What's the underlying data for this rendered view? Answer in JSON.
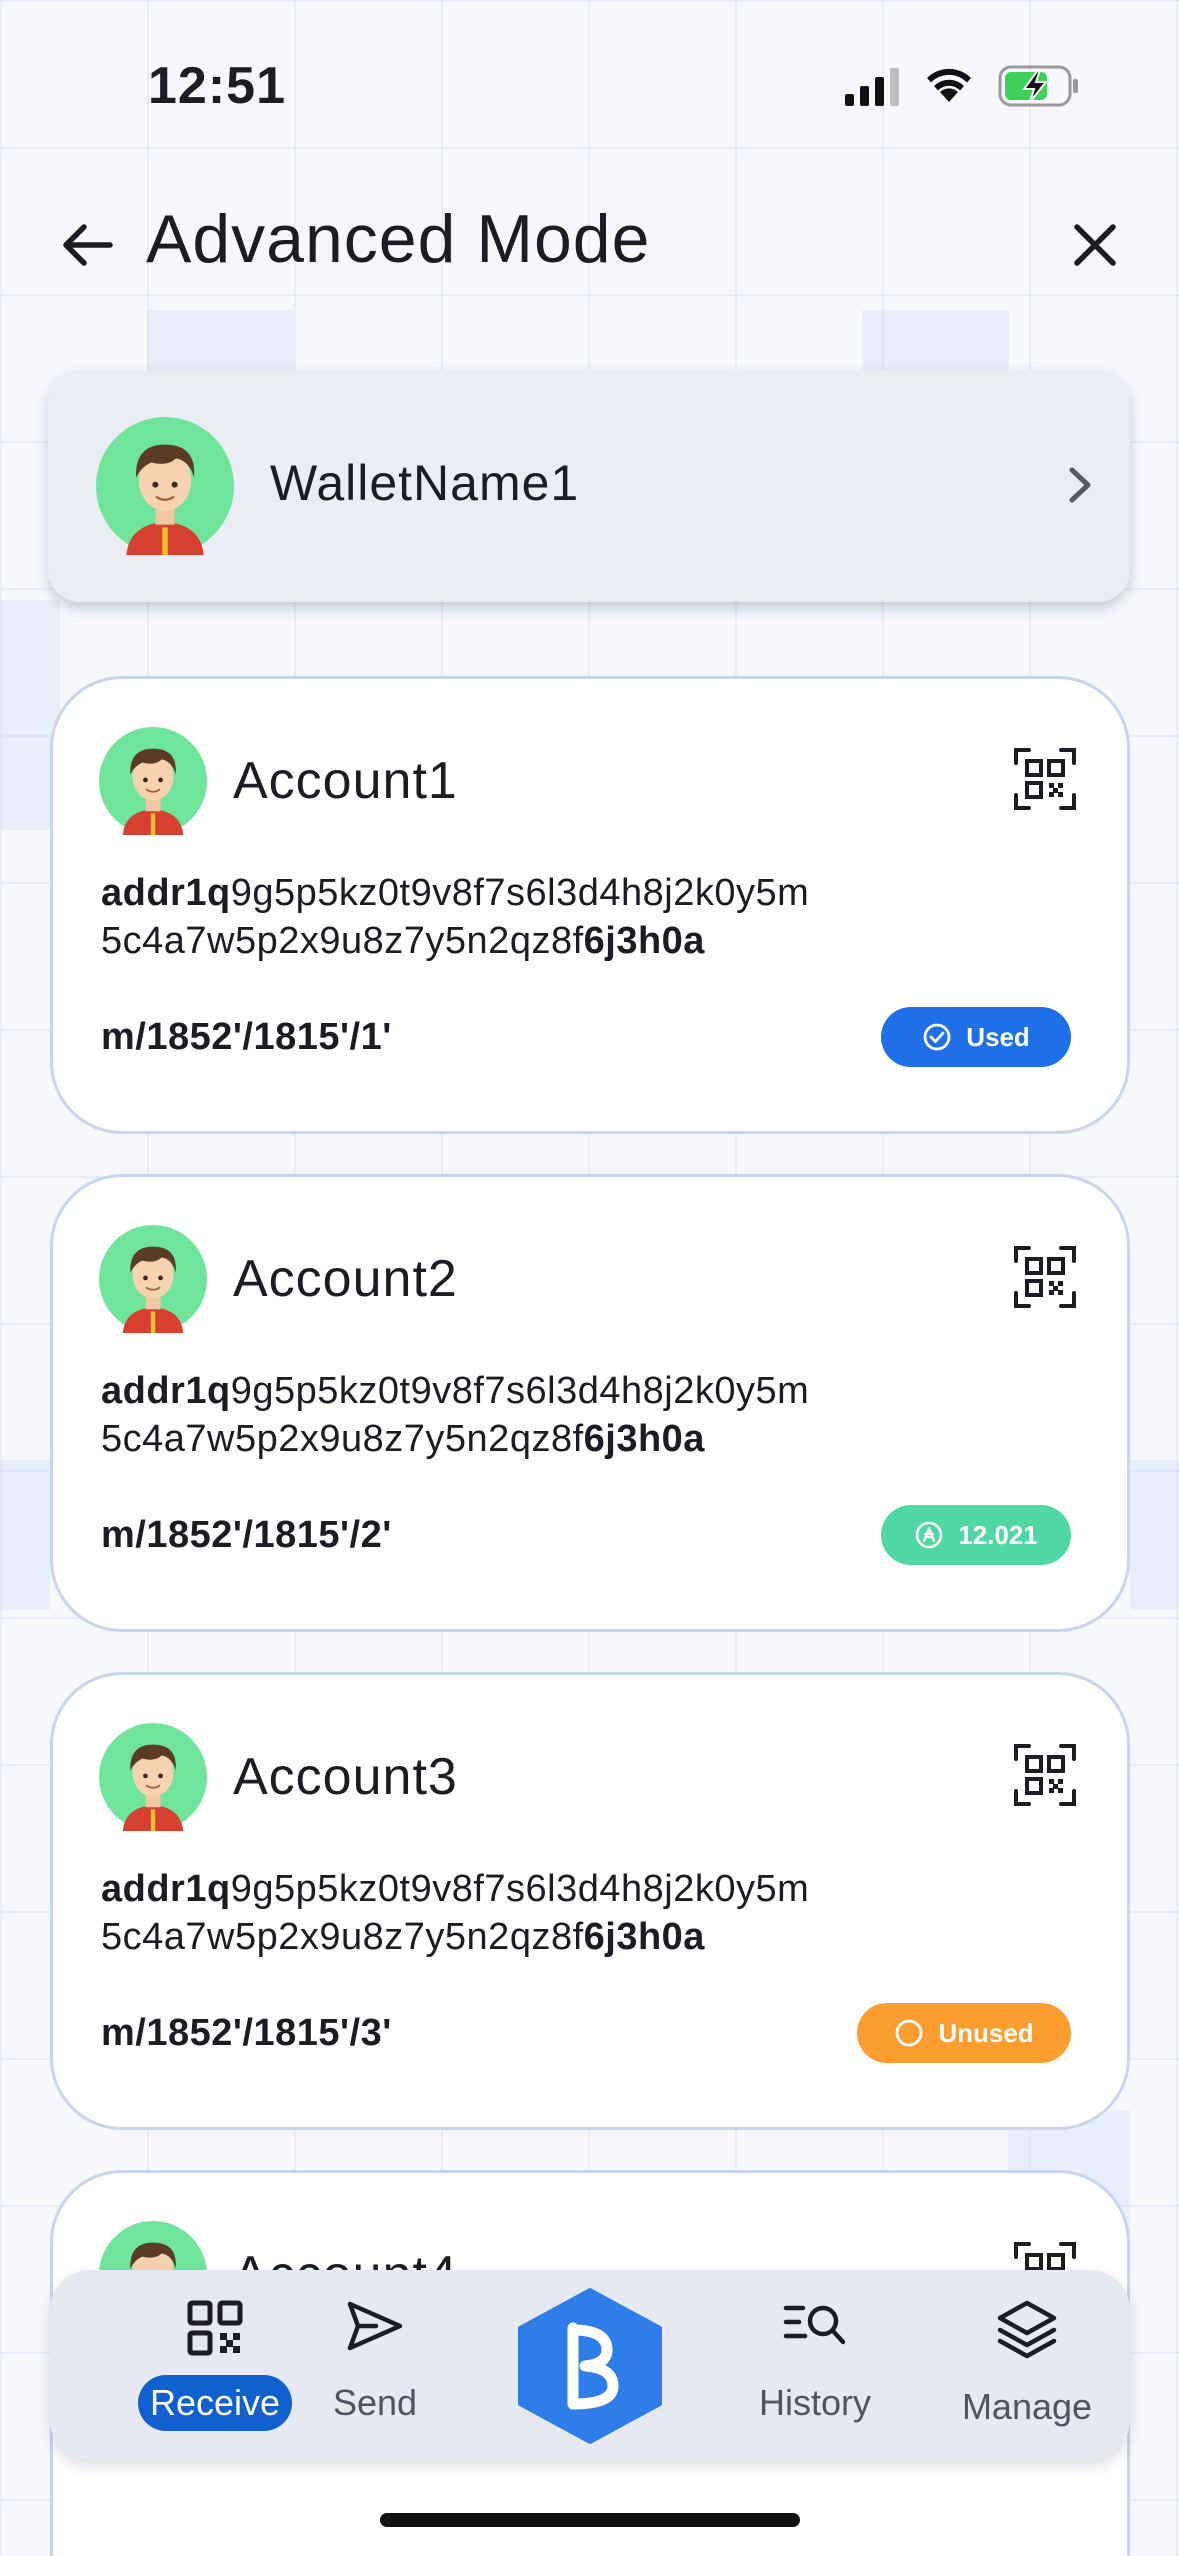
{
  "status_bar": {
    "time": "12:51"
  },
  "header": {
    "title": "Advanced Mode"
  },
  "wallet": {
    "name": "WalletName1"
  },
  "accounts": [
    {
      "name": "Account1",
      "address_prefix": "addr1q",
      "address_middle_line1": "9g5p5kz0t9v8f7s6l3d4h8j2k0y5m",
      "address_middle_line2": "5c4a7w5p2x9u8z7y5n2qz8f",
      "address_suffix": "6j3h0a",
      "path": "m/1852'/1815'/1'",
      "badge": {
        "label": "Used",
        "kind": "used",
        "color": "#1f6fe8"
      }
    },
    {
      "name": "Account2",
      "address_prefix": "addr1q",
      "address_middle_line1": "9g5p5kz0t9v8f7s6l3d4h8j2k0y5m",
      "address_middle_line2": "5c4a7w5p2x9u8z7y5n2qz8f",
      "address_suffix": "6j3h0a",
      "path": "m/1852'/1815'/2'",
      "badge": {
        "label": "12.021",
        "kind": "balance",
        "color": "#4fd8a6"
      }
    },
    {
      "name": "Account3",
      "address_prefix": "addr1q",
      "address_middle_line1": "9g5p5kz0t9v8f7s6l3d4h8j2k0y5m",
      "address_middle_line2": "5c4a7w5p2x9u8z7y5n2qz8f",
      "address_suffix": "6j3h0a",
      "path": "m/1852'/1815'/3'",
      "badge": {
        "label": "Unused",
        "kind": "unused",
        "color": "#fc9e2f"
      }
    },
    {
      "name": "Account4"
    }
  ],
  "nav": {
    "receive": "Receive",
    "send": "Send",
    "history": "History",
    "manage": "Manage",
    "active": "receive"
  },
  "colors": {
    "accent": "#1060d0",
    "logo": "#2f7de8",
    "avatar_bg": "#6ee59a"
  },
  "icons": {
    "back": "arrow-left-icon",
    "close": "close-icon",
    "chevron": "chevron-right-icon",
    "qr": "qr-code-icon",
    "receive": "qr-code-icon",
    "send": "send-icon",
    "history": "history-search-icon",
    "manage": "layers-icon",
    "logo": "brand-logo-icon"
  }
}
